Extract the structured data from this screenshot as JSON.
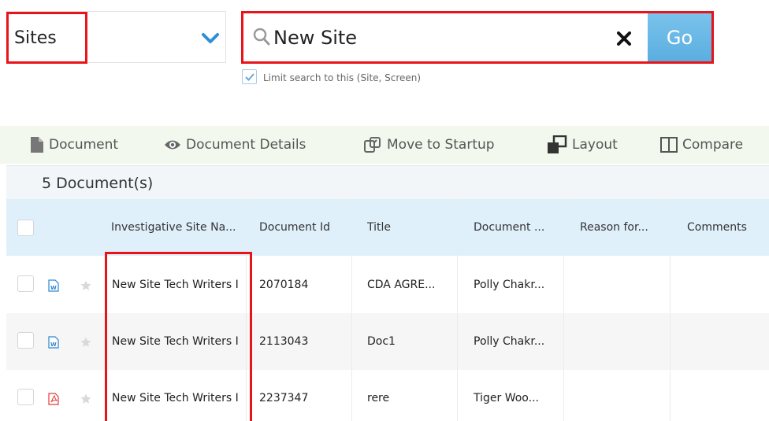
{
  "search": {
    "scope_value": "Sites",
    "query_value": "New Site",
    "go_label": "Go",
    "limit_label": "Limit search to this (Site, Screen)",
    "limit_checked": true
  },
  "toolbar": {
    "items": [
      {
        "label": "Document",
        "icon": "document-icon"
      },
      {
        "label": "Document Details",
        "icon": "eye-icon"
      },
      {
        "label": "Move to Startup",
        "icon": "move-icon"
      },
      {
        "label": "Layout",
        "icon": "layout-icon"
      },
      {
        "label": "Compare",
        "icon": "compare-icon"
      }
    ]
  },
  "grid": {
    "count_label": "5 Document(s)",
    "columns": [
      "Investigative Site Na...",
      "Document Id",
      "Title",
      "Document ...",
      "Reason for...",
      "Comments"
    ],
    "rows": [
      {
        "file_type": "word",
        "site_name": "New Site Tech Writers I",
        "document_id": "2070184",
        "title": "CDA AGRE...",
        "document_owner": "Polly Chakr...",
        "reason": "",
        "comments": ""
      },
      {
        "file_type": "word",
        "site_name": "New Site Tech Writers I",
        "document_id": "2113043",
        "title": "Doc1",
        "document_owner": "Polly Chakr...",
        "reason": "",
        "comments": ""
      },
      {
        "file_type": "pdf",
        "site_name": "New Site Tech Writers I",
        "document_id": "2237347",
        "title": "rere",
        "document_owner": "Tiger Woo...",
        "reason": "",
        "comments": ""
      }
    ]
  },
  "colors": {
    "highlight": "#e8141a",
    "go_button": "#6bbbe8",
    "chevron": "#2d8fd5",
    "word_icon": "#2f86cf",
    "pdf_icon": "#e23c3c"
  }
}
